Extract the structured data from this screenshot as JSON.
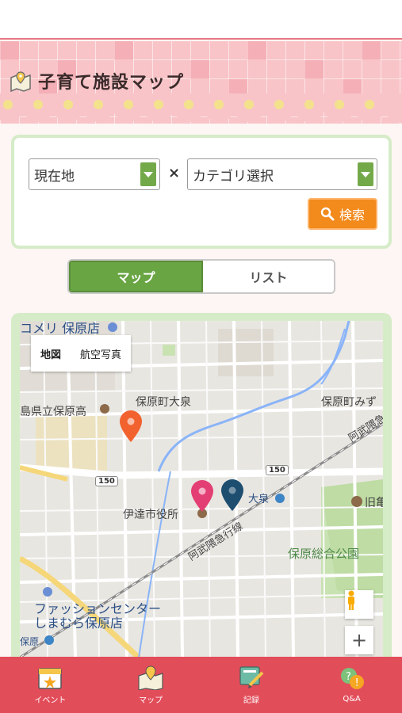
{
  "header": {
    "title": "子育て施設マップ"
  },
  "search": {
    "location_select": "現在地",
    "times_symbol": "×",
    "category_select": "カテゴリ選択",
    "search_label": "検索"
  },
  "tabs": [
    {
      "label": "マップ",
      "active": true
    },
    {
      "label": "リスト",
      "active": false
    }
  ],
  "map": {
    "type_control": [
      "地図",
      "航空写真"
    ],
    "labels": {
      "komeri": "コメリ 保原店",
      "school": "島県立保原高",
      "hobara_oizumi": "保原町大泉",
      "hobara_mizu": "保原町みず",
      "abukuma_line_top": "阿武隈急",
      "date_city_hall": "伊達市役所",
      "oizumi_station": "大泉",
      "kyu": "旧亀",
      "abukuma_line": "阿武隈急行線",
      "hobara_park": "保原総合公園",
      "fashion_center": "ファッションセンター",
      "shimamura": "しまむら保原店",
      "hobara": "保原"
    },
    "routes": [
      "150",
      "150"
    ],
    "pins": [
      {
        "color": "#f2622e"
      },
      {
        "color": "#e33f74"
      },
      {
        "color": "#1d4e70"
      }
    ],
    "zoom_in": "+"
  },
  "nav": [
    {
      "label": "イベント",
      "icon": "calendar-star-icon"
    },
    {
      "label": "マップ",
      "icon": "map-pin-icon"
    },
    {
      "label": "記録",
      "icon": "notebook-pencil-icon"
    },
    {
      "label": "Q&A",
      "icon": "qa-icon"
    }
  ],
  "colors": {
    "header_pink": "#f8c4c8",
    "accent_green": "#6aa544",
    "search_orange": "#f28a1c",
    "nav_red": "#e24d5a"
  }
}
